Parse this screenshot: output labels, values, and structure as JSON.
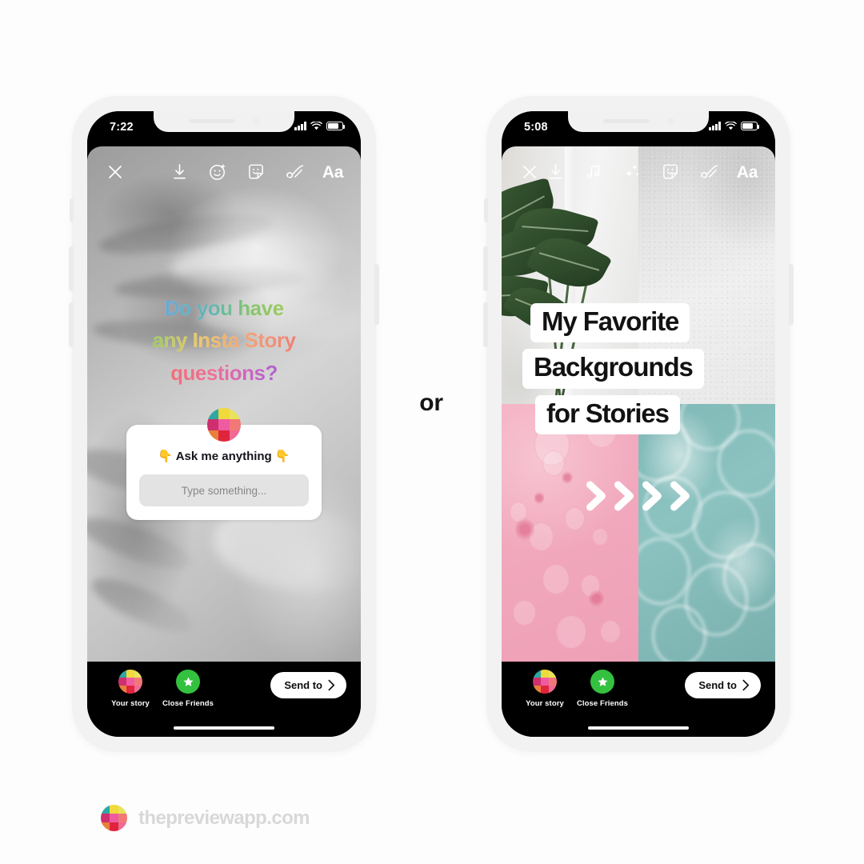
{
  "divider": {
    "label": "or"
  },
  "footer": {
    "brand": "thepreviewapp.com",
    "logo_icon": "preview-grid-logo-icon"
  },
  "phones": [
    {
      "id": "phone-left",
      "status_bar": {
        "time": "7:22",
        "signal_icon": "cellular-bars-icon",
        "wifi_icon": "wifi-icon",
        "battery_icon": "battery-icon"
      },
      "toolbar": {
        "close_icon": "close-x-icon",
        "items": [
          {
            "name": "download-icon",
            "label": "Save"
          },
          {
            "name": "effects-smiley-icon",
            "label": "Effects"
          },
          {
            "name": "sticker-icon",
            "label": "Stickers"
          },
          {
            "name": "draw-squiggle-icon",
            "label": "Draw"
          },
          {
            "name": "text-aa-icon",
            "label": "Aa"
          }
        ]
      },
      "background": {
        "kind": "palm-shadow-grayscale"
      },
      "text_sticker": {
        "lines": [
          "Do you have",
          "any Insta Story",
          "questions?"
        ],
        "gradients": [
          [
            "#6aa8d8",
            "#9ccb62"
          ],
          [
            "#9ccb62",
            "#ef7e75"
          ],
          [
            "#ef6f78",
            "#a964cb"
          ]
        ]
      },
      "question_sticker": {
        "avatar_icon": "preview-grid-logo-icon",
        "prompt": "👇 Ask me anything 👇",
        "input_placeholder": "Type something..."
      },
      "share_bar": {
        "your_story_label": "Your story",
        "your_story_icon": "preview-grid-logo-icon",
        "close_friends_label": "Close Friends",
        "close_friends_icon": "green-star-icon",
        "send_to_label": "Send to",
        "send_to_icon": "chevron-right-icon"
      }
    },
    {
      "id": "phone-right",
      "status_bar": {
        "time": "5:08",
        "signal_icon": "cellular-bars-icon",
        "wifi_icon": "wifi-icon",
        "battery_icon": "battery-icon"
      },
      "toolbar": {
        "close_icon": "close-x-icon",
        "items": [
          {
            "name": "download-icon",
            "label": "Save"
          },
          {
            "name": "music-note-icon",
            "label": "Music"
          },
          {
            "name": "sparkles-icon",
            "label": "Effects"
          },
          {
            "name": "sticker-icon",
            "label": "Stickers"
          },
          {
            "name": "draw-squiggle-icon",
            "label": "Draw"
          },
          {
            "name": "text-aa-icon",
            "label": "Aa"
          }
        ]
      },
      "background": {
        "kind": "four-quadrant-collage",
        "quadrants": [
          {
            "name": "plant-photo",
            "color": "#e9e7e3"
          },
          {
            "name": "white-textured-wall",
            "color": "#e7e7e7"
          },
          {
            "name": "pink-bubbles",
            "color": "#f1a7bb"
          },
          {
            "name": "teal-water",
            "color": "#84bbb9"
          }
        ]
      },
      "text_sticker": {
        "lines": [
          "My Favorite",
          "Backgrounds",
          "for Stories"
        ],
        "color": "#121212"
      },
      "chevrons": {
        "icon": "double-chevron-right-icon",
        "count": 4,
        "color": "#ffffff"
      },
      "share_bar": {
        "your_story_label": "Your story",
        "your_story_icon": "preview-grid-logo-icon",
        "close_friends_label": "Close Friends",
        "close_friends_icon": "green-star-icon",
        "send_to_label": "Send to",
        "send_to_icon": "chevron-right-icon"
      }
    }
  ],
  "brand_palette": {
    "grid_colors": [
      "#2ea8a0",
      "#f0d93c",
      "#e8e35a",
      "#cf2f6e",
      "#ef5ba1",
      "#f27878",
      "#e8803c",
      "#e0243c",
      "#f06a93"
    ]
  }
}
